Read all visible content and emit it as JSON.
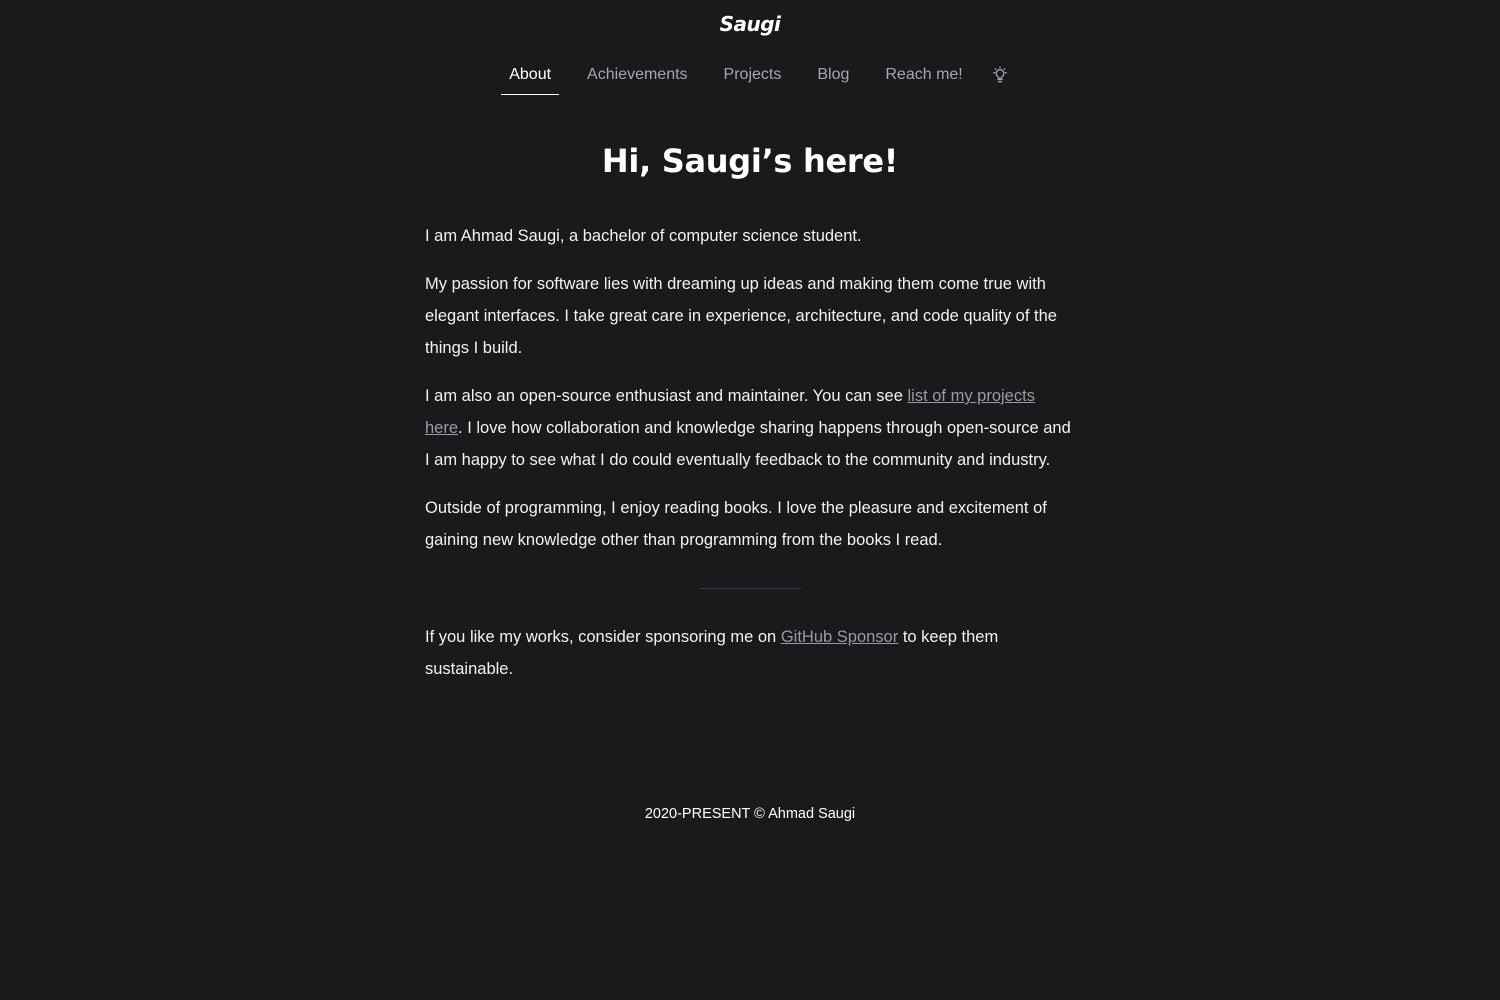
{
  "site": {
    "logo": "Saugi"
  },
  "nav": {
    "items": [
      {
        "label": "About"
      },
      {
        "label": "Achievements"
      },
      {
        "label": "Projects"
      },
      {
        "label": "Blog"
      },
      {
        "label": "Reach me!"
      }
    ],
    "active": "About",
    "theme_toggle_icon": "lightbulb-icon"
  },
  "main": {
    "title": "Hi, Saugi’s here!",
    "intro": "I am Ahmad Saugi, a bachelor of computer science student.",
    "passion": "My passion for software lies with dreaming up ideas and making them come true with elegant interfaces. I take great care in experience, architecture, and code quality of the things I build.",
    "opensource_before": "I am also an open-source enthusiast and maintainer. You can see ",
    "opensource_link": "list of my projects here",
    "opensource_after": ". I love how collaboration and knowledge sharing happens through open-source and I am happy to see what I do could eventually feedback to the community and industry.",
    "reading": "Outside of programming, I enjoy reading books. I love the pleasure and excitement of gaining new knowledge other than programming from the books I read.",
    "sponsor_before": "If you like my works, consider sponsoring me on ",
    "sponsor_link": "GitHub Sponsor",
    "sponsor_after": " to keep them sustainable."
  },
  "footer": {
    "text": "2020-PRESENT © Ahmad Saugi"
  },
  "colors": {
    "background": "#1a1a1c",
    "text": "#f2f2f2",
    "muted": "#a6a6ab",
    "link": "#9a9aa0"
  }
}
